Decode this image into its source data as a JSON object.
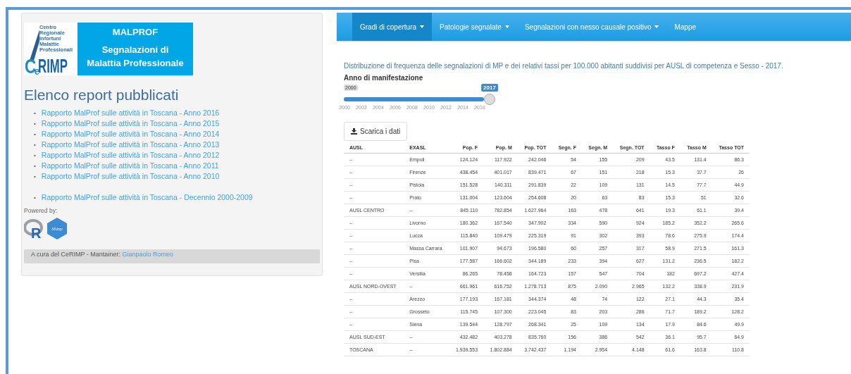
{
  "logo": {
    "caption": "Centro Regionale Infortuni Malattie Professionali",
    "wordmark_c": "C",
    "wordmark_e": "e",
    "wordmark_rest": "RIMP",
    "title": "MALPROF",
    "subtitle": "Segnalazioni di Malattia Professionale"
  },
  "reports": {
    "heading": "Elenco report pubblicati",
    "marker": "•",
    "items": [
      {
        "label": "Rapporto MalProf sulle attività in Toscana - Anno 2016",
        "kind": "year"
      },
      {
        "label": "Rapporto MalProf sulle attività in Toscana - Anno 2015",
        "kind": "year"
      },
      {
        "label": "Rapporto MalProf sulle attività in Toscana - Anno 2014",
        "kind": "year"
      },
      {
        "label": "Rapporto MalProf sulle attività in Toscana - Anno 2013",
        "kind": "year"
      },
      {
        "label": "Rapporto MalProf sulle attività in Toscana - Anno 2012",
        "kind": "year"
      },
      {
        "label": "Rapporto MalProf sulle attività in Toscana - Anno 2011",
        "kind": "year"
      },
      {
        "label": "Rapporto MalProf sulle attività in Toscana - Anno 2010",
        "kind": "year"
      },
      {
        "label": "Rapporto MalProf sulle attività in Toscana - Decennio 2000-2009",
        "kind": "decade"
      }
    ]
  },
  "powered_by": {
    "label": "Powered by:",
    "r_letter": "R",
    "shiny_label": "Shiny"
  },
  "footer": {
    "text": "A cura del CeRIMP - Mantainer:",
    "link": "Gianpaolo Romeo"
  },
  "navbar": [
    {
      "label": "Gradi di copertura",
      "dropdown": true,
      "selected": true
    },
    {
      "label": "Patologie segnalate",
      "dropdown": true,
      "selected": false
    },
    {
      "label": "Segnalazioni con nesso causale positivo",
      "dropdown": true,
      "selected": false
    },
    {
      "label": "Mappe",
      "dropdown": false,
      "selected": false
    }
  ],
  "description": "Distribuzione di frequenza delle segnalazioni di MP e dei relativi tassi per 100.000 abitanti suddivisi per AUSL di competenza e Sesso - 2017.",
  "slider": {
    "label": "Anno di manifestazione",
    "min": "2000",
    "value": "2017",
    "level": 1,
    "ticks": [
      "2000",
      "2002",
      "2004",
      "2006",
      "2008",
      "2010",
      "2012",
      "2014",
      "2016"
    ]
  },
  "download_button": "Scarica i dati",
  "table": {
    "columns": [
      "AUSL",
      "EXASL",
      "Pop. F",
      "Pop. M",
      "Pop. TOT",
      "Segn. F",
      "Segn. M",
      "Segn. TOT",
      "Tasso F",
      "Tasso M",
      "Tasso TOT"
    ],
    "rows": [
      [
        "--",
        "Empoli",
        "124.124",
        "117.922",
        "242.046",
        "54",
        "155",
        "209",
        "43.5",
        "131.4",
        "86.3"
      ],
      [
        "--",
        "Firenze",
        "438.454",
        "401.017",
        "839.471",
        "67",
        "151",
        "218",
        "15.3",
        "37.7",
        "26"
      ],
      [
        "--",
        "Pistoia",
        "151.528",
        "140.311",
        "291.839",
        "22",
        "109",
        "131",
        "14.5",
        "77.7",
        "44.9"
      ],
      [
        "--",
        "Prato",
        "131.004",
        "123.604",
        "254.608",
        "20",
        "63",
        "83",
        "15.3",
        "51",
        "32.6"
      ],
      [
        "AUSL CENTRO",
        "--",
        "845.110",
        "782.854",
        "1.627.964",
        "163",
        "478",
        "641",
        "19.3",
        "61.1",
        "39.4"
      ],
      [
        "--",
        "Livorno",
        "180.362",
        "167.540",
        "347.902",
        "334",
        "590",
        "924",
        "185.2",
        "352.2",
        "265.6"
      ],
      [
        "--",
        "Lucca",
        "115.840",
        "109.479",
        "225.319",
        "91",
        "302",
        "393",
        "78.6",
        "275.9",
        "174.4"
      ],
      [
        "--",
        "Massa Carrara",
        "101.907",
        "94.673",
        "196.580",
        "60",
        "257",
        "317",
        "58.9",
        "271.5",
        "161.3"
      ],
      [
        "--",
        "Pisa",
        "177.587",
        "166.602",
        "344.189",
        "233",
        "394",
        "627",
        "131.2",
        "236.5",
        "182.2"
      ],
      [
        "--",
        "Versilia",
        "86.265",
        "78.458",
        "164.723",
        "157",
        "547",
        "704",
        "182",
        "697.2",
        "427.4"
      ],
      [
        "AUSL NORD-OVEST",
        "--",
        "661.961",
        "616.752",
        "1.278.713",
        "875",
        "2.090",
        "2.965",
        "132.2",
        "338.9",
        "231.9"
      ],
      [
        "--",
        "Arezzo",
        "177.193",
        "167.181",
        "344.374",
        "48",
        "74",
        "122",
        "27.1",
        "44.3",
        "35.4"
      ],
      [
        "--",
        "Grosseto",
        "115.745",
        "107.300",
        "223.045",
        "83",
        "203",
        "286",
        "71.7",
        "189.2",
        "128.2"
      ],
      [
        "--",
        "Siena",
        "139.544",
        "128.797",
        "268.341",
        "25",
        "109",
        "134",
        "17.9",
        "84.6",
        "49.9"
      ],
      [
        "AUSL SUD-EST",
        "--",
        "432.482",
        "403.278",
        "835.760",
        "156",
        "386",
        "542",
        "36.1",
        "95.7",
        "64.9"
      ],
      [
        "TOSCANA",
        "--",
        "1.939.553",
        "1.802.884",
        "3.742.437",
        "1.194",
        "2.954",
        "4.148",
        "61.6",
        "163.8",
        "110.8"
      ]
    ]
  }
}
